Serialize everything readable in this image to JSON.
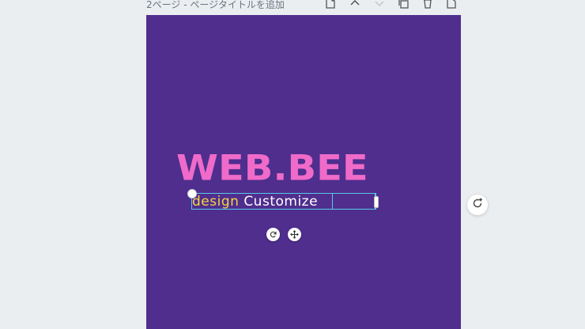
{
  "header": {
    "page_title": "2ページ - ページタイトルを追加",
    "icons": [
      "notes-icon",
      "chevron-up-icon",
      "chevron-down-icon",
      "duplicate-icon",
      "trash-icon",
      "add-page-icon"
    ]
  },
  "canvas": {
    "background_color": "#4f2e8e",
    "brand_title": "WEB.BEE",
    "brand_color": "#f06bc9",
    "text_line": {
      "word1": "design",
      "word1_color": "#f5d442",
      "word2": "Customize",
      "word2_color": "#ffffff"
    },
    "selection_color": "#5ac8e8"
  },
  "controls": {
    "rotate_icon": "rotate-icon",
    "move_icon": "move-icon",
    "side_button_icon": "refresh-add-icon"
  }
}
